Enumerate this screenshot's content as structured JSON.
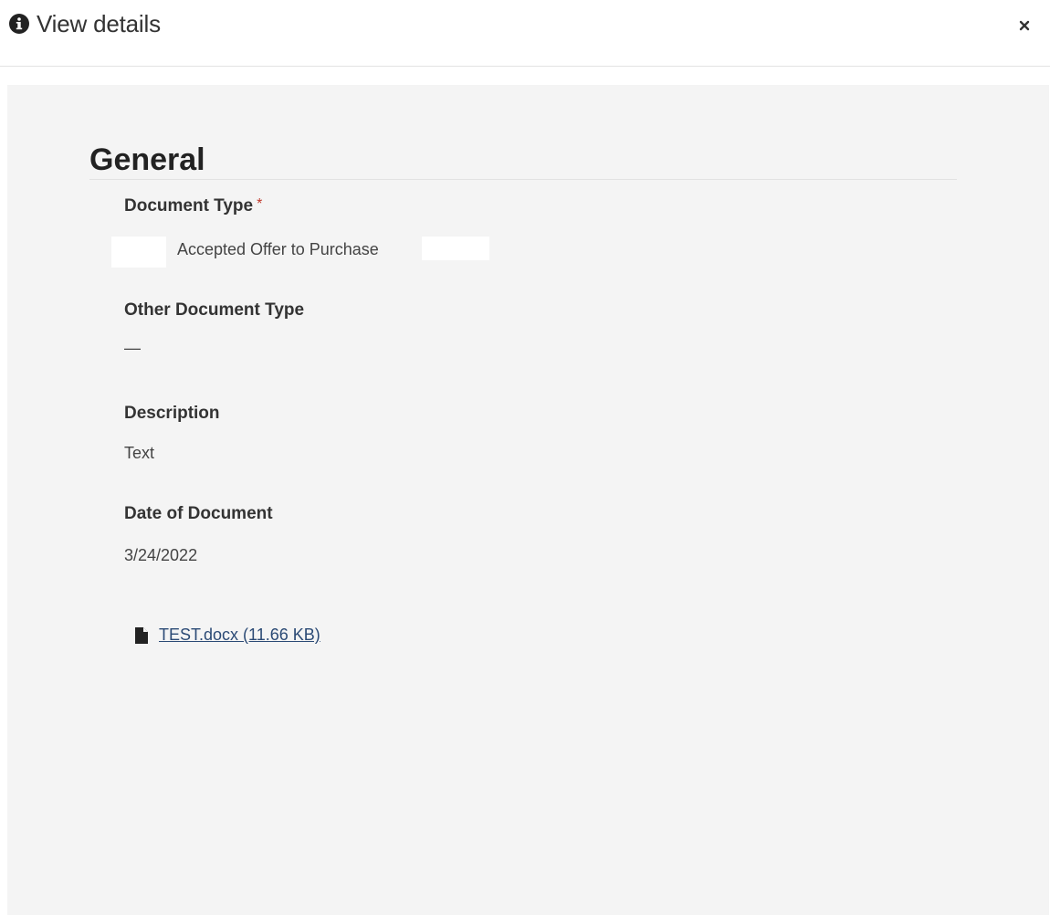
{
  "header": {
    "title": "View details",
    "icon": "info-circle-icon",
    "close_icon": "close-icon"
  },
  "section": {
    "title": "General"
  },
  "fields": {
    "document_type": {
      "label": "Document Type",
      "required_mark": "*",
      "value": "Accepted Offer to Purchase"
    },
    "other_document_type": {
      "label": "Other Document Type",
      "value": "—"
    },
    "description": {
      "label": "Description",
      "value": "Text"
    },
    "date_of_document": {
      "label": "Date of Document",
      "value": "3/24/2022"
    }
  },
  "attachment": {
    "icon": "file-icon",
    "label": "TEST.docx (11.66 KB)"
  },
  "colors": {
    "body_background": "#f4f4f4",
    "link": "#2b4a75",
    "required": "#c0392b"
  }
}
